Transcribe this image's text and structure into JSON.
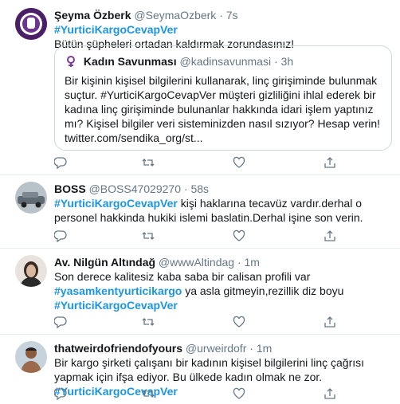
{
  "tweets": [
    {
      "name": "Şeyma Özberk",
      "handle": "@SeymaOzberk",
      "dot": "·",
      "time": "7s",
      "hashtag": "#YurticiKargoCevapVer",
      "text": "Bütün şüpheleri ortadan kaldırmak zorundasınız!",
      "quote": {
        "name": "Kadın Savunması",
        "handle": "@kadinsavunmasi",
        "dot": "·",
        "time": "3h",
        "text": "Bir kişinin kişisel bilgilerini kullanarak, linç girişiminde bulunmak suçtur. #YurticiKargoCevapVer müşteri gizliliğini ihlal ederek bir kadına linç girişiminde bulunanlar hakkında idari işlem yaptınız mı? Kişisel  bilgiler veri sisteminizden nasıl sızıyor? Hesap verin!",
        "link": "twitter.com/sendika_org/st..."
      }
    },
    {
      "name": "BOSS",
      "handle": "@BOSS47029270",
      "dot": "·",
      "time": "58s",
      "hashtag": "#YurticiKargoCevapVer",
      "text": " kişi haklarına tecavüz vardır.derhal o personel hakkinda hukiki islemi baslatin.Derhal işine son verin."
    },
    {
      "name": "Av. Nilgün Altındağ",
      "handle": "@wwwAltindag",
      "dot": "·",
      "time": "1m",
      "line1": "Son derece kalitesiz kaba saba bir calisan profili  var",
      "hashtag2": "#yasamkentyurticikargo",
      "line2": " ya asla gitmeyin,rezillik diz boyu",
      "hashtag": "#YurticiKargoCevapVer"
    },
    {
      "name": "thatweirdofriendofyours",
      "handle": "@urweirdofr",
      "dot": "·",
      "time": "1m",
      "text": "Bir kargo şirketi çalışanı bir kadının kişisel bilgilerini linç çağrısı yapmak için ifşa ediyor. Bu ülkede kadın olmak ne zor.  ",
      "hashtag": "#YurticiKargoCevapVer"
    }
  ],
  "colors": {
    "accent": "#1b95e0",
    "muted": "#657786",
    "border": "#e6ecf0"
  },
  "icons": [
    "reply-icon",
    "retweet-icon",
    "like-icon",
    "share-icon"
  ]
}
